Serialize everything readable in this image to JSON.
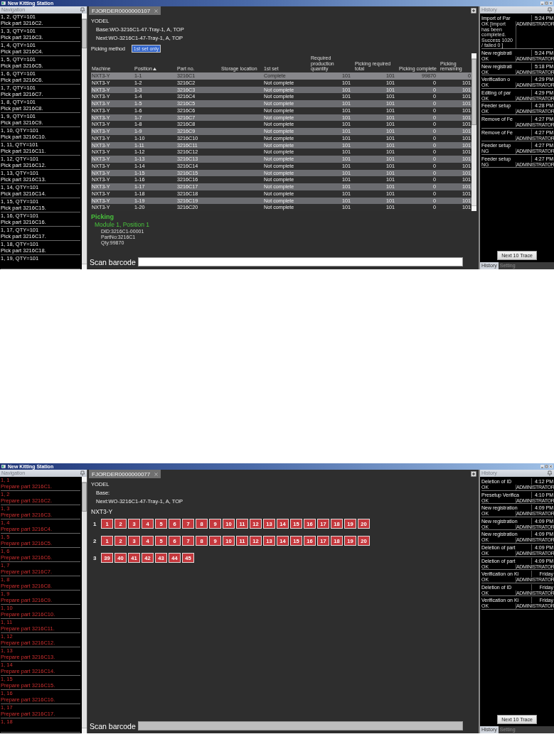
{
  "screens": [
    {
      "window": {
        "title": "New Kitting Station"
      },
      "navigation": {
        "title": "Navigation",
        "items": [
          {
            "kind": "pick",
            "line_1": "1, 2, QTY=101",
            "line_2": "Pick part 3216C2."
          },
          {
            "kind": "pick",
            "line_1": "1, 3, QTY=101",
            "line_2": "Pick part 3216C3."
          },
          {
            "kind": "pick",
            "line_1": "1, 4, QTY=101",
            "line_2": "Pick part 3216C4."
          },
          {
            "kind": "pick",
            "line_1": "1, 5, QTY=101",
            "line_2": "Pick part 3216C5."
          },
          {
            "kind": "pick",
            "line_1": "1, 6, QTY=101",
            "line_2": "Pick part 3216C6."
          },
          {
            "kind": "pick",
            "line_1": "1, 7, QTY=101",
            "line_2": "Pick part 3216C7."
          },
          {
            "kind": "pick",
            "line_1": "1, 8, QTY=101",
            "line_2": "Pick part 3216C8."
          },
          {
            "kind": "pick",
            "line_1": "1, 9, QTY=101",
            "line_2": "Pick part 3216C9."
          },
          {
            "kind": "pick",
            "line_1": "1, 10, QTY=101",
            "line_2": "Pick part 3216C10."
          },
          {
            "kind": "pick",
            "line_1": "1, 11, QTY=101",
            "line_2": "Pick part 3216C11."
          },
          {
            "kind": "pick",
            "line_1": "1, 12, QTY=101",
            "line_2": "Pick part 3216C12."
          },
          {
            "kind": "pick",
            "line_1": "1, 13, QTY=101",
            "line_2": "Pick part 3216C13."
          },
          {
            "kind": "pick",
            "line_1": "1, 14, QTY=101",
            "line_2": "Pick part 3216C14."
          },
          {
            "kind": "pick",
            "line_1": "1, 15, QTY=101",
            "line_2": "Pick part 3216C15."
          },
          {
            "kind": "pick",
            "line_1": "1, 16, QTY=101",
            "line_2": "Pick part 3216C16."
          },
          {
            "kind": "pick",
            "line_1": "1, 17, QTY=101",
            "line_2": "Pick part 3216C17."
          },
          {
            "kind": "pick",
            "line_1": "1, 18, QTY=101",
            "line_2": "Pick part 3216C18."
          },
          {
            "kind": "pick",
            "line_1": "1, 19, QTY=101"
          }
        ]
      },
      "tab": {
        "label": "FJORDER0000000107",
        "selected": true
      },
      "header": {
        "customer": "YODEL",
        "base": "Base:WO-3216C1-47-Tray-1, A, TOP",
        "next": "Next:WO-3216C1-47-Tray-1, A, TOP"
      },
      "content": {
        "kind": "table",
        "picking_method": {
          "label": "Picking method",
          "value": "1st set only"
        },
        "table": {
          "columns": [
            {
              "label": "Machine"
            },
            {
              "label": "Position",
              "sorted": true
            },
            {
              "label": "Part no."
            },
            {
              "label": "Storage location"
            },
            {
              "label": "1st set"
            },
            {
              "label": "Required production quantity",
              "numeric": true
            },
            {
              "label": "Picking required total",
              "numeric": true
            },
            {
              "label": "Picking complete",
              "numeric": true
            },
            {
              "label": "Picking remaining",
              "numeric": true
            }
          ],
          "rows": [
            {
              "selected": true,
              "cells": [
                "NXT3-Y",
                "1-1",
                "3216C1",
                "",
                "Complete",
                "101",
                "101",
                "99870",
                "0"
              ]
            },
            {
              "selected": false,
              "cells": [
                "NXT3-Y",
                "1-2",
                "3216C2",
                "",
                "Not complete",
                "101",
                "101",
                "0",
                "101"
              ]
            },
            {
              "selected": false,
              "cells": [
                "NXT3-Y",
                "1-3",
                "3216C3",
                "",
                "Not complete",
                "101",
                "101",
                "0",
                "101"
              ]
            },
            {
              "selected": false,
              "cells": [
                "NXT3-Y",
                "1-4",
                "3216C4",
                "",
                "Not complete",
                "101",
                "101",
                "0",
                "101"
              ]
            },
            {
              "selected": false,
              "cells": [
                "NXT3-Y",
                "1-5",
                "3216C5",
                "",
                "Not complete",
                "101",
                "101",
                "0",
                "101"
              ]
            },
            {
              "selected": false,
              "cells": [
                "NXT3-Y",
                "1-6",
                "3216C6",
                "",
                "Not complete",
                "101",
                "101",
                "0",
                "101"
              ]
            },
            {
              "selected": false,
              "cells": [
                "NXT3-Y",
                "1-7",
                "3216C7",
                "",
                "Not complete",
                "101",
                "101",
                "0",
                "101"
              ]
            },
            {
              "selected": false,
              "cells": [
                "NXT3-Y",
                "1-8",
                "3216C8",
                "",
                "Not complete",
                "101",
                "101",
                "0",
                "101"
              ]
            },
            {
              "selected": false,
              "cells": [
                "NXT3-Y",
                "1-9",
                "3216C9",
                "",
                "Not complete",
                "101",
                "101",
                "0",
                "101"
              ]
            },
            {
              "selected": false,
              "cells": [
                "NXT3-Y",
                "1-10",
                "3216C10",
                "",
                "Not complete",
                "101",
                "101",
                "0",
                "101"
              ]
            },
            {
              "selected": false,
              "cells": [
                "NXT3-Y",
                "1-11",
                "3216C11",
                "",
                "Not complete",
                "101",
                "101",
                "0",
                "101"
              ]
            },
            {
              "selected": false,
              "cells": [
                "NXT3-Y",
                "1-12",
                "3216C12",
                "",
                "Not complete",
                "101",
                "101",
                "0",
                "101"
              ]
            },
            {
              "selected": false,
              "cells": [
                "NXT3-Y",
                "1-13",
                "3216C13",
                "",
                "Not complete",
                "101",
                "101",
                "0",
                "101"
              ]
            },
            {
              "selected": false,
              "cells": [
                "NXT3-Y",
                "1-14",
                "3216C14",
                "",
                "Not complete",
                "101",
                "101",
                "0",
                "101"
              ]
            },
            {
              "selected": false,
              "cells": [
                "NXT3-Y",
                "1-15",
                "3216C15",
                "",
                "Not complete",
                "101",
                "101",
                "0",
                "101"
              ]
            },
            {
              "selected": false,
              "cells": [
                "NXT3-Y",
                "1-16",
                "3216C16",
                "",
                "Not complete",
                "101",
                "101",
                "0",
                "101"
              ]
            },
            {
              "selected": false,
              "cells": [
                "NXT3-Y",
                "1-17",
                "3216C17",
                "",
                "Not complete",
                "101",
                "101",
                "0",
                "101"
              ]
            },
            {
              "selected": false,
              "cells": [
                "NXT3-Y",
                "1-18",
                "3216C18",
                "",
                "Not complete",
                "101",
                "101",
                "0",
                "101"
              ]
            },
            {
              "selected": false,
              "cells": [
                "NXT3-Y",
                "1-19",
                "3216C19",
                "",
                "Not complete",
                "101",
                "101",
                "0",
                "101"
              ]
            },
            {
              "selected": false,
              "cells": [
                "NXT3-Y",
                "1-20",
                "3216C20",
                "",
                "Not complete",
                "101",
                "101",
                "0",
                "101"
              ]
            }
          ]
        },
        "picking": {
          "title": "Picking",
          "location": "Module 1, Position 1",
          "details": [
            "DID:3216C1-00001",
            "PartNo:3216C1",
            "Qty:99870"
          ]
        }
      },
      "scan": {
        "label": "Scan barcode",
        "disabled": false
      },
      "history": {
        "title": "History",
        "items": [
          {
            "title": "Import of Par",
            "time": "5:24 PM",
            "status": "OK [Import has been completed. Success 1020 / failed 0 ]",
            "user": "ADMINISTRATOR"
          },
          {
            "title": "New registrati",
            "time": "5:24 PM",
            "status": "OK",
            "user": "ADMINISTRATOR"
          },
          {
            "title": "New registrati",
            "time": "5:18 PM",
            "status": "OK",
            "user": "ADMINISTRATOR"
          },
          {
            "title": "Verification o",
            "time": "4:29 PM",
            "status": "OK",
            "user": "ADMINISTRATOR"
          },
          {
            "title": "Editing of par",
            "time": "4:29 PM",
            "status": "OK",
            "user": "ADMINISTRATOR"
          },
          {
            "title": "Feeder setup",
            "time": "4:28 PM",
            "status": "OK",
            "user": "ADMINISTRATOR"
          },
          {
            "title": "Remove of Fe",
            "time": "4:27 PM",
            "user": "ADMINISTRATOR"
          },
          {
            "title": "Remove of Fe",
            "time": "4:27 PM",
            "user": "ADMINISTRATOR"
          },
          {
            "title": "Feeder setup",
            "time": "4:27 PM",
            "status": "NG",
            "user": "ADMINISTRATOR"
          },
          {
            "title": "Feeder setup",
            "time": "4:27 PM",
            "status": "NG",
            "user": "ADMINISTRATOR"
          }
        ],
        "button": "Next 10 Trace",
        "tabs": [
          {
            "label": "History",
            "selected": true
          },
          {
            "label": "Setting",
            "selected": false
          }
        ]
      }
    },
    {
      "window": {
        "title": "New Kitting Station"
      },
      "navigation": {
        "title": "Navigation",
        "items": [
          {
            "kind": "prepare",
            "line_1": "1, 1",
            "line_2": "Prepare part 3216C1."
          },
          {
            "kind": "prepare",
            "line_1": "1, 2",
            "line_2": "Prepare part 3216C2."
          },
          {
            "kind": "prepare",
            "line_1": "1, 3",
            "line_2": "Prepare part 3216C3."
          },
          {
            "kind": "prepare",
            "line_1": "1, 4",
            "line_2": "Prepare part 3216C4."
          },
          {
            "kind": "prepare",
            "line_1": "1, 5",
            "line_2": "Prepare part 3216C5."
          },
          {
            "kind": "prepare",
            "line_1": "1, 6",
            "line_2": "Prepare part 3216C6."
          },
          {
            "kind": "prepare",
            "line_1": "1, 7",
            "line_2": "Prepare part 3216C7."
          },
          {
            "kind": "prepare",
            "line_1": "1, 8",
            "line_2": "Prepare part 3216C8."
          },
          {
            "kind": "prepare",
            "line_1": "1, 9",
            "line_2": "Prepare part 3216C9."
          },
          {
            "kind": "prepare",
            "line_1": "1, 10",
            "line_2": "Prepare part 3216C10."
          },
          {
            "kind": "prepare",
            "line_1": "1, 11",
            "line_2": "Prepare part 3216C11."
          },
          {
            "kind": "prepare",
            "line_1": "1, 12",
            "line_2": "Prepare part 3216C12."
          },
          {
            "kind": "prepare",
            "line_1": "1, 13",
            "line_2": "Prepare part 3216C13."
          },
          {
            "kind": "prepare",
            "line_1": "1, 14",
            "line_2": "Prepare part 3216C14."
          },
          {
            "kind": "prepare",
            "line_1": "1, 15",
            "line_2": "Prepare part 3216C15."
          },
          {
            "kind": "prepare",
            "line_1": "1, 16",
            "line_2": "Prepare part 3216C16."
          },
          {
            "kind": "prepare",
            "line_1": "1, 17",
            "line_2": "Prepare part 3216C17."
          },
          {
            "kind": "prepare",
            "line_1": "1, 18"
          }
        ]
      },
      "tab": {
        "label": "FJORDER0000000077",
        "selected": true
      },
      "header": {
        "customer": "YODEL",
        "base": "Base:",
        "next": "Next:WO-3216C1-47-Tray-1, A, TOP"
      },
      "content": {
        "kind": "grid",
        "machine": "NXT3-Y",
        "modules": [
          {
            "label": "1",
            "positions": [
              "1",
              "2",
              "3",
              "4",
              "5",
              "6",
              "7",
              "8",
              "9",
              "10",
              "11",
              "12",
              "13",
              "14",
              "15",
              "16",
              "17",
              "18",
              "19",
              "20"
            ]
          },
          {
            "label": "2",
            "positions": [
              "1",
              "2",
              "3",
              "4",
              "5",
              "6",
              "7",
              "8",
              "9",
              "10",
              "11",
              "12",
              "13",
              "14",
              "15",
              "16",
              "17",
              "18",
              "19",
              "20"
            ]
          },
          {
            "label": "3",
            "positions": [
              "39",
              "40",
              "41",
              "42",
              "43",
              "44",
              "45"
            ]
          }
        ]
      },
      "scan": {
        "label": "Scan barcode",
        "disabled": true
      },
      "history": {
        "title": "History",
        "items": [
          {
            "title": "Deletion of ID",
            "time": "4:12 PM",
            "status": "OK",
            "user": "ADMINISTRATOR"
          },
          {
            "title": "Presetup Verifica",
            "time": "4:10 PM",
            "status": "OK",
            "user": "ADMINISTRATOR"
          },
          {
            "title": "New registration",
            "time": "4:09 PM",
            "status": "OK",
            "user": "ADMINISTRATOR"
          },
          {
            "title": "New registration",
            "time": "4:09 PM",
            "status": "OK",
            "user": "ADMINISTRATOR"
          },
          {
            "title": "New registration",
            "time": "4:09 PM",
            "status": "OK",
            "user": "ADMINISTRATOR"
          },
          {
            "title": "Deletion of part",
            "time": "4:09 PM",
            "status": "OK",
            "user": "ADMINISTRATOR"
          },
          {
            "title": "Deletion of part",
            "time": "4:09 PM",
            "status": "OK",
            "user": "ADMINISTRATOR"
          },
          {
            "title": "Verification on Ki",
            "time": "Friday",
            "status": "OK",
            "user": "ADMINISTRATOR"
          },
          {
            "title": "Deletion of ID",
            "time": "Friday",
            "status": "OK",
            "user": "ADMINISTRATOR"
          },
          {
            "title": "Verification on Ki",
            "time": "Friday",
            "status": "OK",
            "user": "ADMINISTRATOR"
          }
        ],
        "button": "Next 10 Trace",
        "tabs": [
          {
            "label": "History",
            "selected": true
          },
          {
            "label": "Setting",
            "selected": false
          }
        ]
      }
    }
  ]
}
